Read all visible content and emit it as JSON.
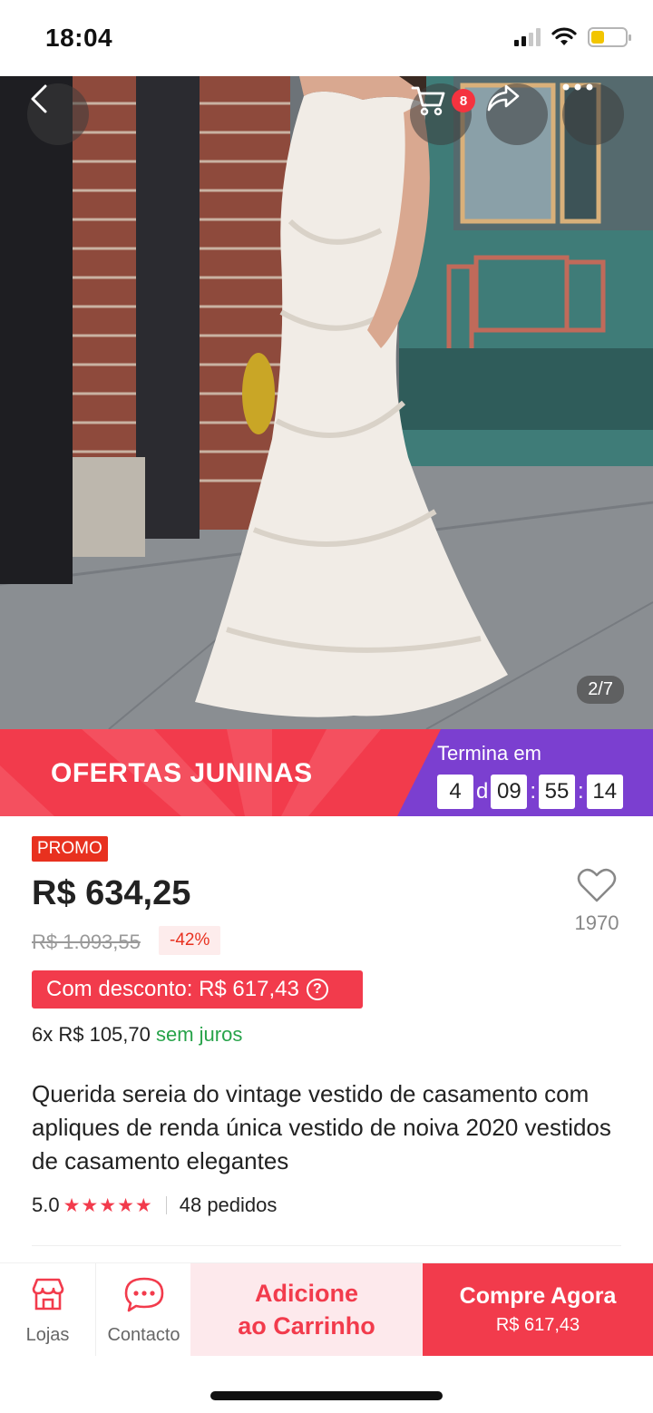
{
  "status_bar": {
    "time": "18:04"
  },
  "hero": {
    "cart_count": "8",
    "image_counter": "2/7"
  },
  "banner": {
    "title": "OFERTAS JUNINAS",
    "timer_label": "Termina em",
    "days": "4",
    "days_unit": "d",
    "hours": "09",
    "minutes": "55",
    "seconds": "14"
  },
  "product": {
    "promo_tag": "PROMO",
    "price": "R$ 634,25",
    "old_price": "R$ 1.093,55",
    "discount": "-42%",
    "wishlist_count": "1970",
    "coupon_text": "Com desconto: R$ 617,43",
    "coupon_help": "?",
    "installments": "6x R$ 105,70",
    "installments_note": "sem juros",
    "title": "Querida sereia do vintage vestido de casamento com apliques de renda única vestido de noiva 2020 vestidos de casamento elegantes",
    "rating": "5.0",
    "stars": "★★★★★",
    "orders": "48 pedidos"
  },
  "bottom_bar": {
    "stores_label": "Lojas",
    "contact_label": "Contacto",
    "add_to_cart_line1": "Adicione",
    "add_to_cart_line2": "ao Carrinho",
    "buy_now_label": "Compre Agora",
    "buy_now_price": "R$ 617,43"
  },
  "colors": {
    "accent_red": "#f23b4c",
    "timer_purple": "#7b3fd0",
    "promo_red": "#e8311f",
    "success_green": "#27a34a"
  },
  "icons": [
    "back-icon",
    "cart-icon",
    "share-icon",
    "more-icon",
    "heart-icon",
    "store-icon",
    "chat-icon",
    "signal-icon",
    "wifi-icon",
    "battery-icon"
  ]
}
